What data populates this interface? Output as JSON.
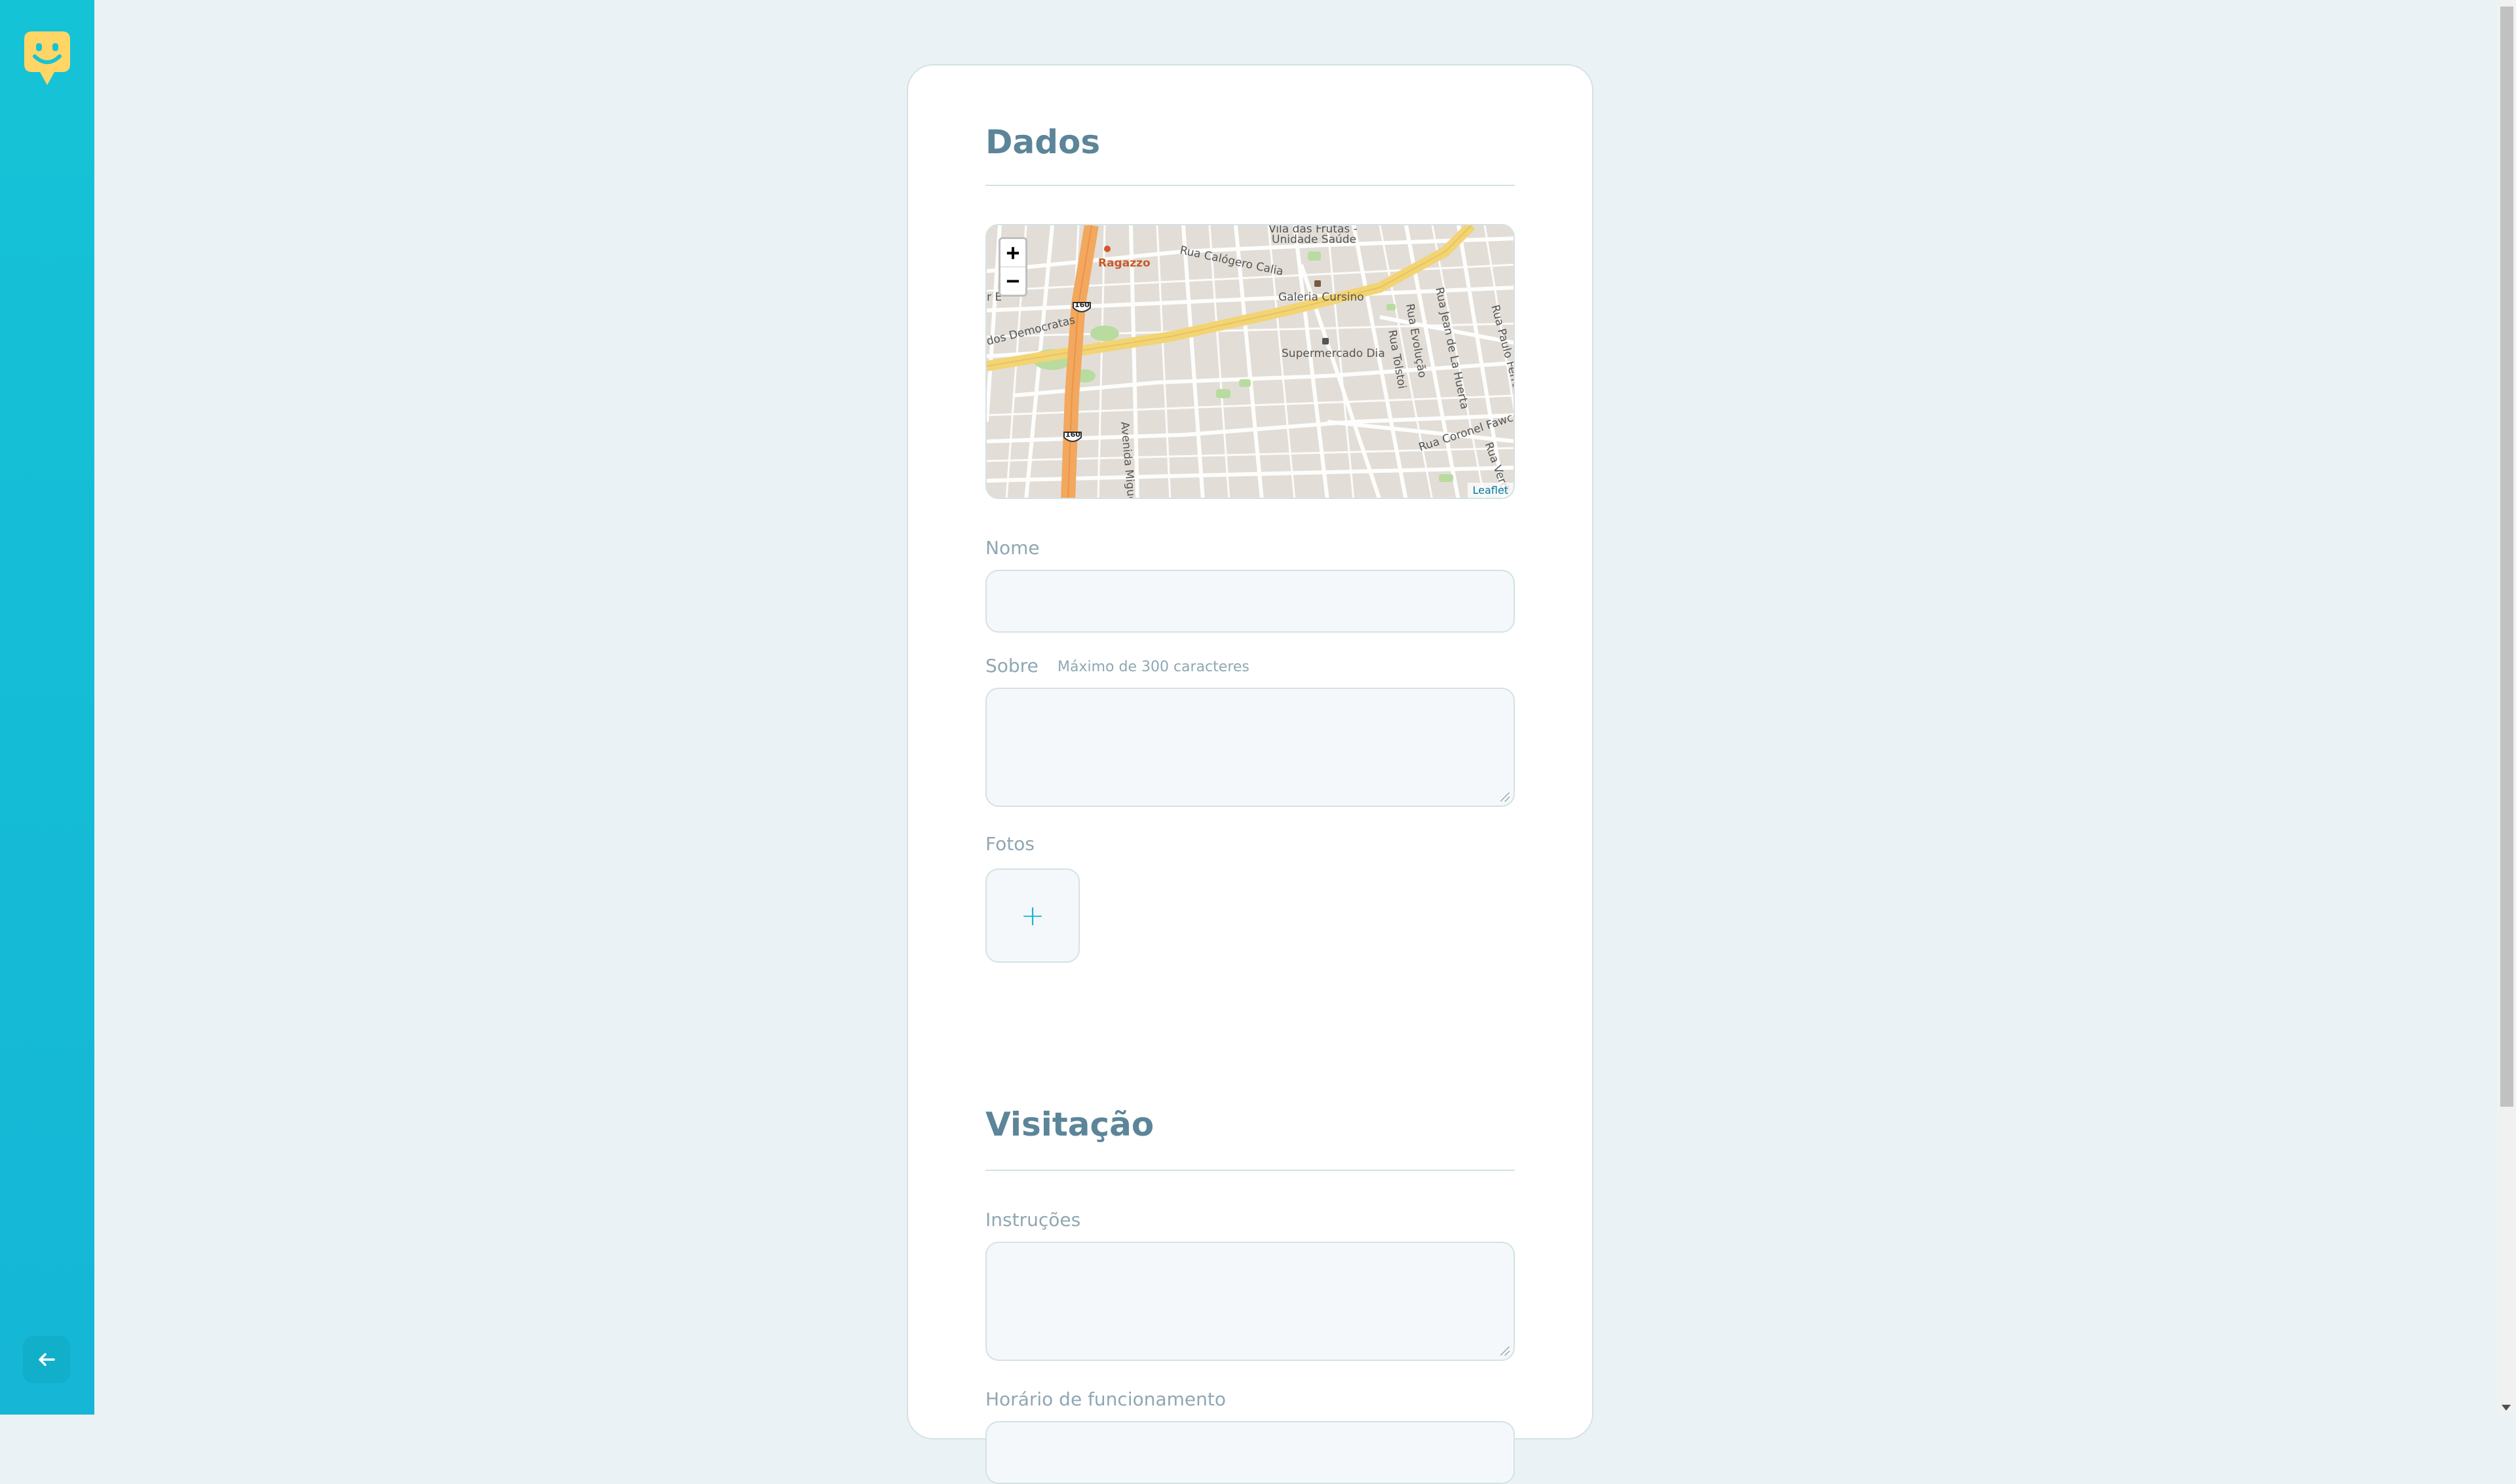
{
  "sidebar": {
    "logo_icon": "happy-face-marker-icon",
    "back_icon": "arrow-left-icon",
    "brand_color": "#FFD666",
    "gradient": [
      "#15c3d6",
      "#15b6d6"
    ]
  },
  "form": {
    "section_data_title": "Dados",
    "map": {
      "zoom_in": "+",
      "zoom_out": "−",
      "attribution": "Leaflet",
      "labels": {
        "ragazzo": "Ragazzo",
        "vila": "Vila das Frutas -",
        "unidade": "Unidade Saúde",
        "calogero": "Rua Calógero Calia",
        "galeria": "Galeria Cursino",
        "supermercado": "Supermercado Dia",
        "democratas": "dos Democratas",
        "e_letter": "r E",
        "avenida": "Avenida Miguel",
        "evolucao": "Rua Evolução",
        "tolstoi": "Rua Tolstoi",
        "jean": "Rua Jean de La Huerta",
        "paulo": "Rua Paulo Ferraz",
        "coronel": "Rua Coronel Fawcett",
        "verdi": "Rua Verdi",
        "route_160a": "160",
        "route_160b": "160"
      }
    },
    "name_label": "Nome",
    "name_value": "",
    "about_label": "Sobre",
    "about_hint": "Máximo de 300 caracteres",
    "about_value": "",
    "photos_label": "Fotos",
    "add_photo_symbol": "+",
    "section_visit_title": "Visitação",
    "instructions_label": "Instruções",
    "instructions_value": "",
    "hours_label": "Horário de funcionamento",
    "hours_value": ""
  }
}
